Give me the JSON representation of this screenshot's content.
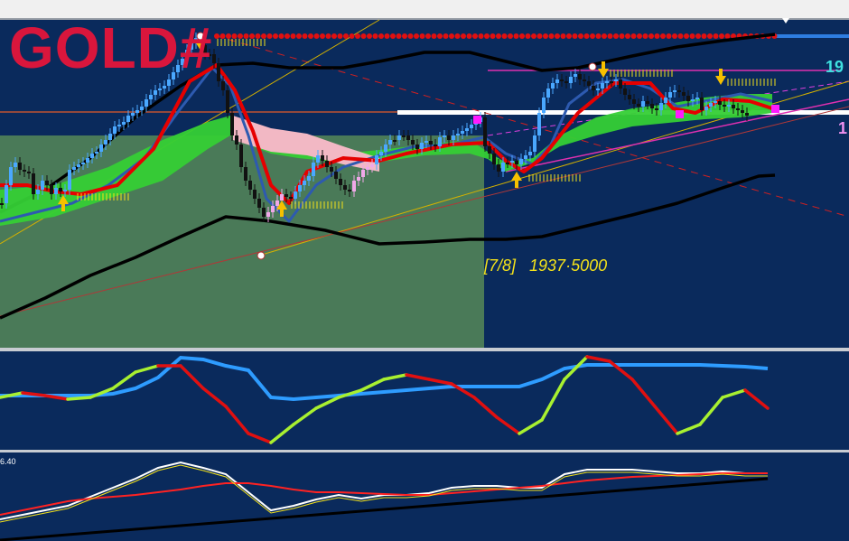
{
  "symbol": "GOLD#",
  "annotation": "[7/8]   1937·5000",
  "right_labels": [
    "19",
    "1"
  ],
  "osc2_level_label": "6.40",
  "colors": {
    "background": "#0a2a5c",
    "shaded_zone": "#4a7a58",
    "bull_candle": "#4aa8ff",
    "bear_candle": "#111111",
    "pink_candle": "#f0a8e8",
    "title": "#d9163c",
    "annotation": "#f4e21a",
    "label_cyan": "#3fe0e0"
  },
  "chart_data": [
    {
      "type": "candlestick",
      "title": "GOLD#",
      "x": [
        0,
        5,
        10,
        15,
        20,
        25,
        30,
        35,
        40,
        45,
        50,
        55,
        60,
        65,
        70,
        75,
        80,
        85,
        90,
        95,
        100,
        105,
        110,
        115,
        120,
        125,
        130,
        135,
        140,
        145,
        150,
        155,
        160,
        165,
        170,
        175,
        180,
        185,
        190,
        195,
        200,
        205,
        210,
        215,
        220,
        225,
        230,
        235,
        240,
        245,
        250,
        255,
        260,
        265,
        270,
        275,
        280,
        285,
        290,
        295,
        300,
        305,
        310,
        315,
        320,
        325,
        330,
        335,
        340,
        345,
        350,
        355,
        360,
        365,
        370,
        375,
        380,
        385,
        390,
        395,
        400,
        405,
        410,
        415,
        420,
        425,
        430,
        435,
        440,
        445,
        450,
        455,
        460,
        465,
        470,
        475,
        480,
        485,
        490,
        495,
        500,
        505,
        510,
        515,
        520,
        525,
        530,
        535,
        540,
        545,
        550,
        555,
        560,
        565,
        570,
        575,
        580,
        585,
        590,
        595,
        600,
        605,
        610,
        615,
        620,
        625,
        630,
        635,
        640,
        645,
        650,
        655,
        660,
        665,
        670,
        675,
        680,
        685,
        690,
        695,
        700,
        705,
        710,
        715,
        720,
        725,
        730,
        735,
        740,
        745,
        750,
        755,
        760,
        765,
        770,
        775,
        780,
        785,
        790,
        795,
        800,
        805,
        810,
        815,
        820,
        825,
        830,
        835,
        840,
        845,
        850,
        855
      ],
      "close": [
        225,
        205,
        185,
        180,
        188,
        190,
        192,
        215,
        210,
        200,
        205,
        215,
        208,
        212,
        210,
        188,
        185,
        182,
        180,
        175,
        170,
        168,
        160,
        155,
        148,
        140,
        138,
        135,
        128,
        125,
        122,
        118,
        110,
        105,
        100,
        98,
        95,
        88,
        80,
        72,
        65,
        55,
        48,
        42,
        50,
        60,
        60,
        70,
        90,
        100,
        125,
        150,
        160,
        185,
        200,
        210,
        220,
        230,
        240,
        235,
        228,
        222,
        215,
        218,
        220,
        212,
        205,
        200,
        195,
        180,
        172,
        178,
        185,
        190,
        198,
        205,
        210,
        212,
        200,
        196,
        188,
        185,
        182,
        172,
        168,
        160,
        155,
        155,
        150,
        150,
        155,
        160,
        165,
        158,
        156,
        160,
        162,
        152,
        150,
        155,
        150,
        148,
        145,
        142,
        138,
        135,
        130,
        162,
        170,
        182,
        190,
        180,
        180,
        178,
        182,
        176,
        172,
        168,
        150,
        125,
        108,
        98,
        92,
        88,
        90,
        92,
        85,
        82,
        88,
        90,
        95,
        100,
        98,
        92,
        90,
        90,
        88,
        98,
        105,
        110,
        115,
        118,
        112,
        115,
        120,
        122,
        114,
        108,
        102,
        100,
        102,
        106,
        112,
        110,
        108,
        122,
        118,
        114,
        112,
        116,
        118,
        116,
        120,
        122,
        125,
        128
      ],
      "y_range": [
        0,
        390
      ]
    },
    {
      "type": "line",
      "name": "oscillator 1",
      "x": [
        0,
        25,
        50,
        75,
        100,
        125,
        150,
        175,
        200,
        225,
        250,
        275,
        300,
        325,
        350,
        375,
        400,
        425,
        450,
        475,
        500,
        525,
        550,
        575,
        600,
        625,
        650,
        675,
        700,
        725,
        750,
        775,
        800,
        825,
        850
      ],
      "series": [
        {
          "color": "gradient",
          "values": [
            440,
            435,
            438,
            442,
            440,
            430,
            412,
            405,
            405,
            430,
            450,
            480,
            490,
            470,
            452,
            440,
            432,
            420,
            415,
            420,
            425,
            440,
            462,
            480,
            465,
            420,
            395,
            400,
            420,
            450,
            480,
            470,
            440,
            432,
            452
          ]
        },
        {
          "color": "#2e9cff",
          "values": [
            438,
            438,
            438,
            438,
            438,
            436,
            430,
            418,
            396,
            398,
            405,
            410,
            440,
            442,
            440,
            438,
            436,
            434,
            432,
            430,
            428,
            428,
            428,
            428,
            420,
            408,
            404,
            404,
            404,
            404,
            404,
            404,
            405,
            406,
            408
          ]
        }
      ],
      "y_range": [
        390,
        500
      ]
    },
    {
      "type": "line",
      "name": "oscillator 2",
      "x": [
        0,
        25,
        50,
        75,
        100,
        125,
        150,
        175,
        200,
        225,
        250,
        275,
        300,
        325,
        350,
        375,
        400,
        425,
        450,
        475,
        500,
        525,
        550,
        575,
        600,
        625,
        650,
        675,
        700,
        725,
        750,
        775,
        800,
        825,
        850
      ],
      "series": [
        {
          "color": "#fff",
          "values": [
            575,
            570,
            565,
            560,
            550,
            540,
            530,
            518,
            512,
            518,
            525,
            545,
            565,
            560,
            553,
            548,
            552,
            548,
            548,
            546,
            540,
            538,
            538,
            540,
            540,
            525,
            520,
            520,
            520,
            522,
            524,
            524,
            522,
            524,
            524
          ]
        },
        {
          "color": "#ff2222",
          "values": [
            570,
            565,
            560,
            555,
            552,
            550,
            548,
            545,
            542,
            538,
            535,
            535,
            538,
            542,
            545,
            545,
            546,
            547,
            548,
            548,
            546,
            544,
            542,
            540,
            538,
            535,
            532,
            530,
            528,
            527,
            526,
            525,
            524,
            524,
            524
          ]
        },
        {
          "color": "#000",
          "values": [
            598,
            596,
            594,
            592,
            590,
            588,
            586,
            584,
            582,
            580,
            578,
            576,
            574,
            572,
            570,
            568,
            566,
            564,
            562,
            560,
            558,
            556,
            554,
            552,
            550,
            548,
            546,
            544,
            542,
            540,
            538,
            536,
            534,
            532,
            530
          ]
        }
      ],
      "y_range": [
        500,
        599
      ]
    }
  ]
}
